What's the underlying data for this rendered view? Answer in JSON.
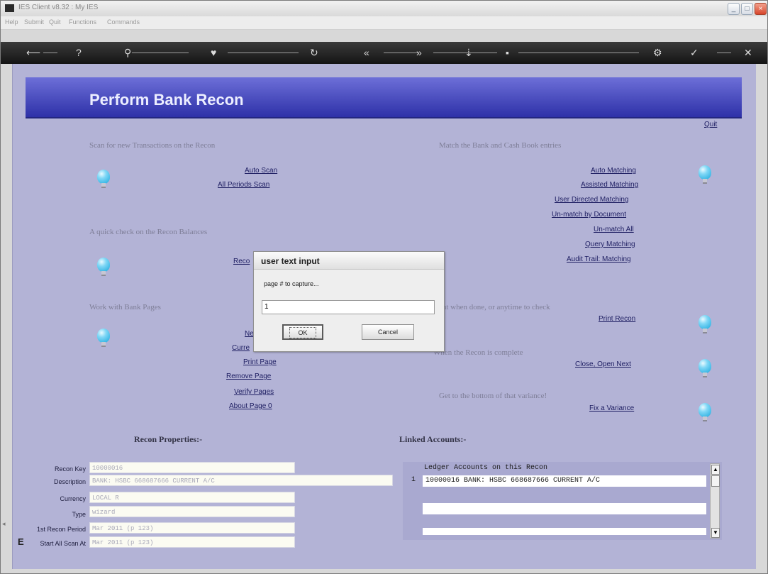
{
  "window": {
    "title": "IES Client v8.32 : My IES"
  },
  "menu": [
    "Help",
    "Submit",
    "Quit",
    "Functions",
    "Commands"
  ],
  "page": {
    "title": "Perform Bank Recon",
    "quit": "Quit"
  },
  "sections": {
    "scan": "Scan for new Transactions on the Recon",
    "quick": "A quick check on the Recon Balances",
    "work": "Work with Bank Pages",
    "match": "Match the Bank and Cash Book entries",
    "print": "Print when done, or anytime to check",
    "complete": "When the Recon is complete",
    "variance": "Get to the bottom of that variance!"
  },
  "left_links": {
    "auto_scan": "Auto Scan",
    "all_periods_scan": "All Periods Scan",
    "recon_partial": "Reco",
    "new_partial": "Ne",
    "current_partial": "Curre",
    "print_page": "Print Page",
    "remove_page": "Remove Page",
    "verify_pages": "Verify Pages",
    "about_page": "About Page 0"
  },
  "right_links": {
    "auto_matching": "Auto Matching",
    "assisted_matching": "Assisted Matching",
    "user_directed_matching": "User Directed Matching",
    "unmatch_by_document": "Un-match by Document",
    "unmatch_all": "Un-match All",
    "query_matching": "Query Matching",
    "audit_trail_matching": "Audit Trail: Matching",
    "print_recon": "Print Recon",
    "close_open_next": "Close, Open Next",
    "fix_variance": "Fix a Variance"
  },
  "properties": {
    "heading": "Recon Properties:-",
    "fields": [
      {
        "label": "Recon Key",
        "value": "10000016"
      },
      {
        "label": "Description",
        "value": "BANK: HSBC 668687666 CURRENT A/C"
      },
      {
        "label": "Currency",
        "value": "LOCAL R"
      },
      {
        "label": "Type",
        "value": "wizard"
      },
      {
        "label": "1st Recon Period",
        "value": "Mar 2011 (p 123)"
      },
      {
        "label": "Start All Scan At",
        "value": "Mar 2011 (p 123)"
      }
    ]
  },
  "linked": {
    "heading": "Linked Accounts:-",
    "column": "Ledger Accounts on this Recon",
    "row_num": "1",
    "row": "10000016 BANK: HSBC 668687666 CURRENT A/C"
  },
  "dialog": {
    "title": "user text input",
    "prompt": "page # to capture...",
    "value": "1",
    "ok": "OK",
    "cancel": "Cancel"
  }
}
